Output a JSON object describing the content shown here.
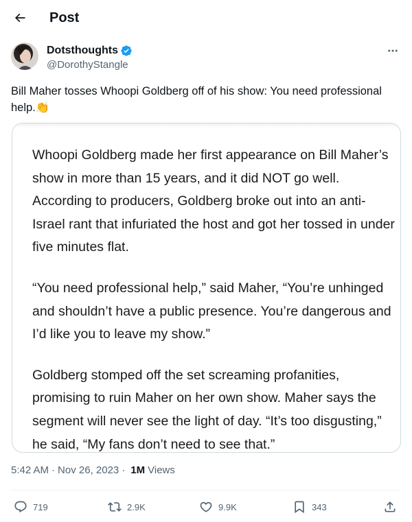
{
  "header": {
    "title": "Post"
  },
  "author": {
    "display_name": "Dotsthoughts",
    "handle": "@DorothyStangle",
    "verified": true
  },
  "tweet": {
    "text": "Bill Maher tosses Whoopi Goldberg off of his show: You need professional help.👏"
  },
  "media_card": {
    "paragraphs": [
      "Whoopi Goldberg made her first appearance on Bill Maher’s show in more than 15 years, and it did NOT go well. According to producers, Goldberg broke out into an anti-Israel rant that infuriated the host and got her tossed in under five minutes flat.",
      "“You need professional help,” said Maher, “You’re unhinged and shouldn’t have a public presence. You’re dangerous and I’d like you to leave my show.”",
      "Goldberg stomped off the set screaming profanities, promising to ruin Maher on her own show. Maher says the segment will never see the light of day. “It’s too disgusting,” he said, “My fans don’t need to see that.”"
    ]
  },
  "meta": {
    "time": "5:42 AM",
    "date": "Nov 26, 2023",
    "views_count": "1M",
    "views_label": "Views"
  },
  "actions": {
    "replies": "719",
    "reposts": "2.9K",
    "likes": "9.9K",
    "bookmarks": "343"
  },
  "colors": {
    "text_primary": "#0f1419",
    "text_secondary": "#536471",
    "verified_blue": "#1d9bf0",
    "border": "#cfd9de"
  },
  "icons": [
    "back-arrow-icon",
    "verified-badge-icon",
    "more-icon",
    "reply-icon",
    "repost-icon",
    "like-icon",
    "bookmark-icon",
    "share-icon"
  ]
}
